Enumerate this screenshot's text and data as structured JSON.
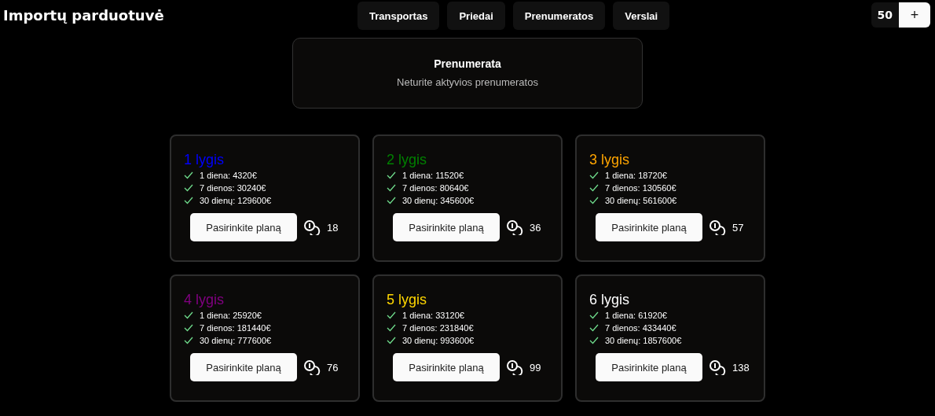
{
  "header": {
    "title": "Importų parduotuvė",
    "nav": [
      {
        "label": "Transportas"
      },
      {
        "label": "Priedai"
      },
      {
        "label": "Prenumeratos"
      },
      {
        "label": "Verslai"
      }
    ],
    "balance": "50",
    "add_button": "+"
  },
  "subscription": {
    "title": "Prenumerata",
    "message": "Neturite aktyvios prenumeratos"
  },
  "plans": [
    {
      "title": "1 lygis",
      "color": "#0000ff",
      "prices": [
        "1 diena: 4320€",
        "7 dienos: 30240€",
        "30 dienų: 129600€"
      ],
      "button": "Pasirinkite planą",
      "coins": "18"
    },
    {
      "title": "2 lygis",
      "color": "#008000",
      "prices": [
        "1 diena: 11520€",
        "7 dienos: 80640€",
        "30 dienų: 345600€"
      ],
      "button": "Pasirinkite planą",
      "coins": "36"
    },
    {
      "title": "3 lygis",
      "color": "#ffa500",
      "prices": [
        "1 diena: 18720€",
        "7 dienos: 130560€",
        "30 dienų: 561600€"
      ],
      "button": "Pasirinkite planą",
      "coins": "57"
    },
    {
      "title": "4 lygis",
      "color": "#800080",
      "prices": [
        "1 diena: 25920€",
        "7 dienos: 181440€",
        "30 dienų: 777600€"
      ],
      "button": "Pasirinkite planą",
      "coins": "76"
    },
    {
      "title": "5 lygis",
      "color": "#ffd700",
      "prices": [
        "1 diena: 33120€",
        "7 dienos: 231840€",
        "30 dienų: 993600€"
      ],
      "button": "Pasirinkite planą",
      "coins": "99"
    },
    {
      "title": "6 lygis",
      "color": "#ffffff",
      "prices": [
        "1 diena: 61920€",
        "7 dienos: 433440€",
        "30 dienų: 1857600€"
      ],
      "button": "Pasirinkite planą",
      "coins": "138"
    }
  ]
}
